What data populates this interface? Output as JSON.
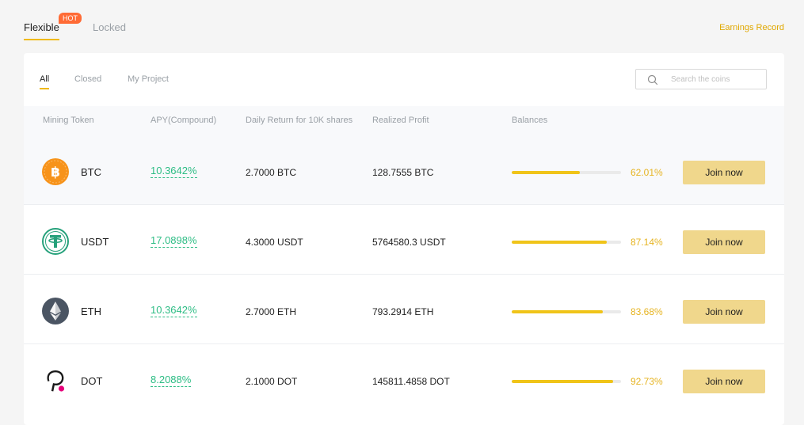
{
  "top_tabs": {
    "flexible": "Flexible",
    "hot_badge": "HOT",
    "locked": "Locked"
  },
  "earnings_record": "Earnings Record",
  "sub_tabs": {
    "all": "All",
    "closed": "Closed",
    "my_project": "My Project"
  },
  "search": {
    "placeholder": "Search the coins",
    "value": ""
  },
  "table": {
    "headers": {
      "token": "Mining Token",
      "apy": "APY(Compound)",
      "daily": "Daily Return for 10K shares",
      "profit": "Realized Profit",
      "balances": "Balances"
    },
    "join_label": "Join now",
    "rows": [
      {
        "coin": "BTC",
        "icon": "bitcoin-icon",
        "color": "#f7931a",
        "apy": "10.3642%",
        "daily": "2.7000 BTC",
        "profit": "128.7555 BTC",
        "balance_pct": "62.01%",
        "balance_fraction": 0.6201
      },
      {
        "coin": "USDT",
        "icon": "tether-icon",
        "color": "#26a17b",
        "apy": "17.0898%",
        "daily": "4.3000 USDT",
        "profit": "5764580.3 USDT",
        "balance_pct": "87.14%",
        "balance_fraction": 0.8714
      },
      {
        "coin": "ETH",
        "icon": "ethereum-icon",
        "color": "#4b5563",
        "apy": "10.3642%",
        "daily": "2.7000 ETH",
        "profit": "793.2914 ETH",
        "balance_pct": "83.68%",
        "balance_fraction": 0.8368
      },
      {
        "coin": "DOT",
        "icon": "polkadot-icon",
        "color": "#1a1a1a",
        "apy": "8.2088%",
        "daily": "2.1000 DOT",
        "profit": "145811.4858 DOT",
        "balance_pct": "92.73%",
        "balance_fraction": 0.9273
      }
    ]
  },
  "colors": {
    "accent": "#f0b90b",
    "apy_green": "#2ebd85",
    "percent_gold": "#e6b422",
    "button_bg": "#f0d78c",
    "hot_badge": "#ff6b35"
  }
}
